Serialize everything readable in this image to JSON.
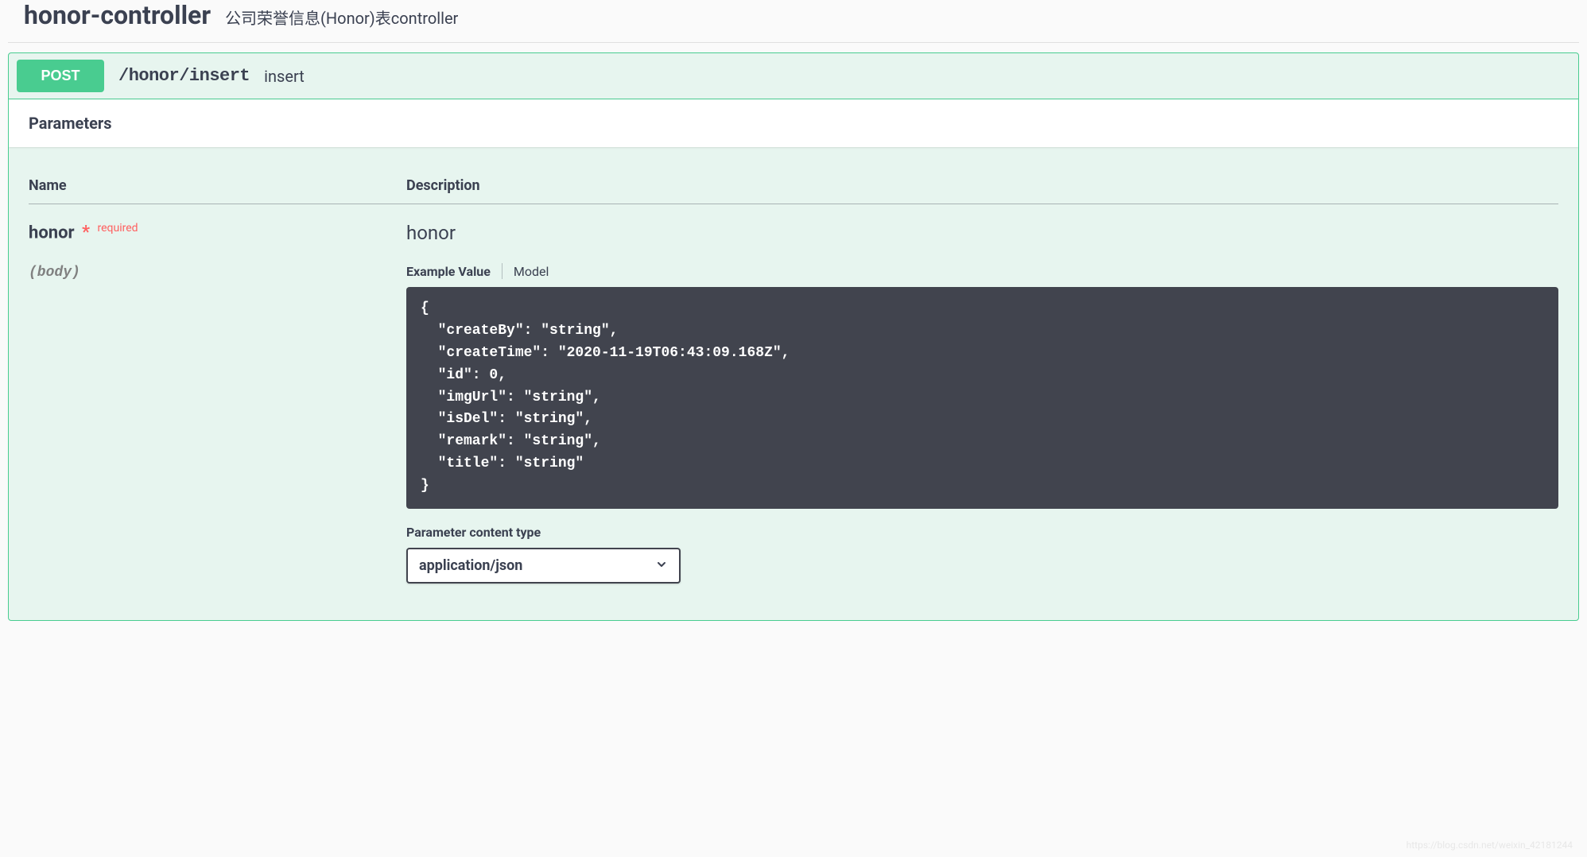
{
  "tag": {
    "name": "honor-controller",
    "description": "公司荣誉信息(Honor)表controller"
  },
  "operation": {
    "method": "POST",
    "path": "/honor/insert",
    "summary": "insert"
  },
  "sections": {
    "parameters_title": "Parameters"
  },
  "param_headers": {
    "name": "Name",
    "description": "Description"
  },
  "parameter": {
    "name": "honor",
    "required_star": "*",
    "required_label": "required",
    "in": "(body)",
    "description": "honor",
    "tabs": {
      "example": "Example Value",
      "model": "Model"
    },
    "example": "{\n  \"createBy\": \"string\",\n  \"createTime\": \"2020-11-19T06:43:09.168Z\",\n  \"id\": 0,\n  \"imgUrl\": \"string\",\n  \"isDel\": \"string\",\n  \"remark\": \"string\",\n  \"title\": \"string\"\n}",
    "content_type_label": "Parameter content type",
    "content_type_value": "application/json"
  },
  "watermark": "https://blog.csdn.net/weixin_42181244"
}
